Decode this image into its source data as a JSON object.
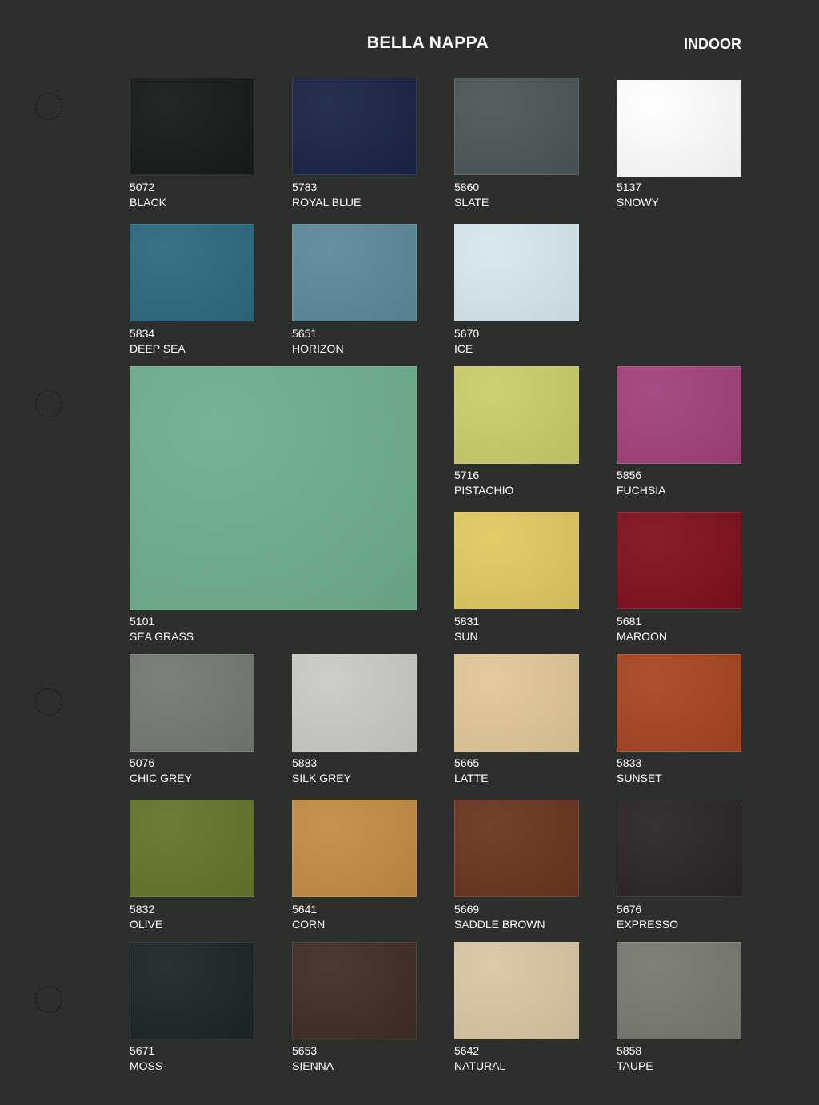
{
  "header": {
    "title": "BELLA NAPPA",
    "category": "INDOOR"
  },
  "swatches": [
    {
      "code": "5072",
      "name": "BLACK",
      "color": "#171a1b"
    },
    {
      "code": "5783",
      "name": "ROYAL BLUE",
      "color": "#1a2446"
    },
    {
      "code": "5860",
      "name": "SLATE",
      "color": "#4c5659"
    },
    {
      "code": "5137",
      "name": "SNOWY",
      "color": "#ffffff"
    },
    {
      "code": "5834",
      "name": "DEEP SEA",
      "color": "#2d6a80"
    },
    {
      "code": "5651",
      "name": "HORIZON",
      "color": "#5d8a9b"
    },
    {
      "code": "5670",
      "name": "ICE",
      "color": "#d6e8f0"
    },
    {
      "code": "5101",
      "name": "SEA GRASS",
      "color": "#70ae8e"
    },
    {
      "code": "5716",
      "name": "PISTACHIO",
      "color": "#cccc6d"
    },
    {
      "code": "5856",
      "name": "FUCHSIA",
      "color": "#a2427b"
    },
    {
      "code": "5831",
      "name": "SUN",
      "color": "#e2c962"
    },
    {
      "code": "5681",
      "name": "MAROON",
      "color": "#7f1020"
    },
    {
      "code": "5076",
      "name": "CHIC GREY",
      "color": "#737a74"
    },
    {
      "code": "5883",
      "name": "SILK GREY",
      "color": "#c9ccc5"
    },
    {
      "code": "5665",
      "name": "LATTE",
      "color": "#e2c79a"
    },
    {
      "code": "5833",
      "name": "SUNSET",
      "color": "#a84622"
    },
    {
      "code": "5832",
      "name": "OLIVE",
      "color": "#64762d"
    },
    {
      "code": "5641",
      "name": "CORN",
      "color": "#c38c44"
    },
    {
      "code": "5669",
      "name": "SADDLE BROWN",
      "color": "#6a3620"
    },
    {
      "code": "5676",
      "name": "EXPRESSO",
      "color": "#2c2525"
    },
    {
      "code": "5671",
      "name": "MOSS",
      "color": "#1d2526"
    },
    {
      "code": "5653",
      "name": "SIENNA",
      "color": "#3f2e25"
    },
    {
      "code": "5642",
      "name": "NATURAL",
      "color": "#d9c8a6"
    },
    {
      "code": "5858",
      "name": "TAUPE",
      "color": "#787a72"
    }
  ]
}
